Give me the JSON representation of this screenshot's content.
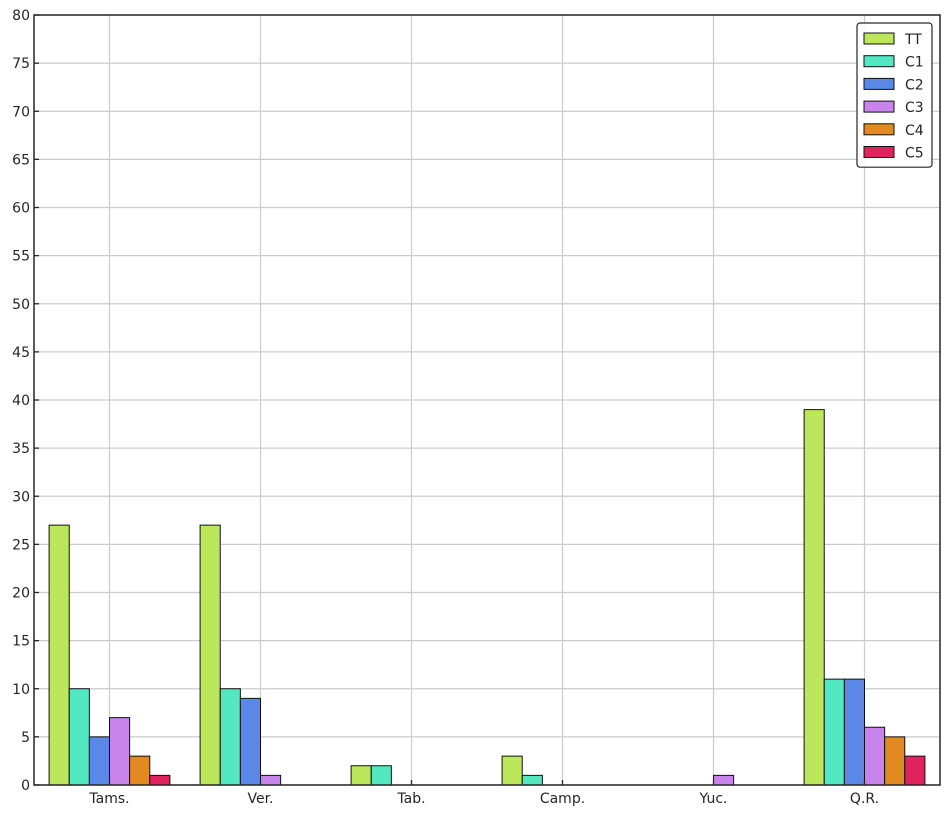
{
  "chart_data": {
    "type": "bar",
    "categories": [
      "Tams.",
      "Ver.",
      "Tab.",
      "Camp.",
      "Yuc.",
      "Q.R."
    ],
    "series": [
      {
        "name": "TT",
        "color": "#bde75a",
        "values": [
          27,
          27,
          2,
          3,
          0,
          39
        ]
      },
      {
        "name": "C1",
        "color": "#52e8c1",
        "values": [
          10,
          10,
          2,
          1,
          0,
          11
        ]
      },
      {
        "name": "C2",
        "color": "#5b88e6",
        "values": [
          5,
          9,
          0,
          0,
          0,
          11
        ]
      },
      {
        "name": "C3",
        "color": "#c984ec",
        "values": [
          7,
          1,
          0,
          0,
          1,
          6
        ]
      },
      {
        "name": "C4",
        "color": "#e08a1f",
        "values": [
          3,
          0,
          0,
          0,
          0,
          5
        ]
      },
      {
        "name": "C5",
        "color": "#e0225f",
        "values": [
          1,
          0,
          0,
          0,
          0,
          3
        ]
      }
    ],
    "ylim": [
      0,
      80
    ],
    "yticks": [
      0,
      5,
      10,
      15,
      20,
      25,
      30,
      35,
      40,
      45,
      50,
      55,
      60,
      65,
      70,
      75,
      80
    ],
    "title": "",
    "xlabel": "",
    "ylabel": "",
    "grid": true,
    "legend_position": "top-right"
  }
}
